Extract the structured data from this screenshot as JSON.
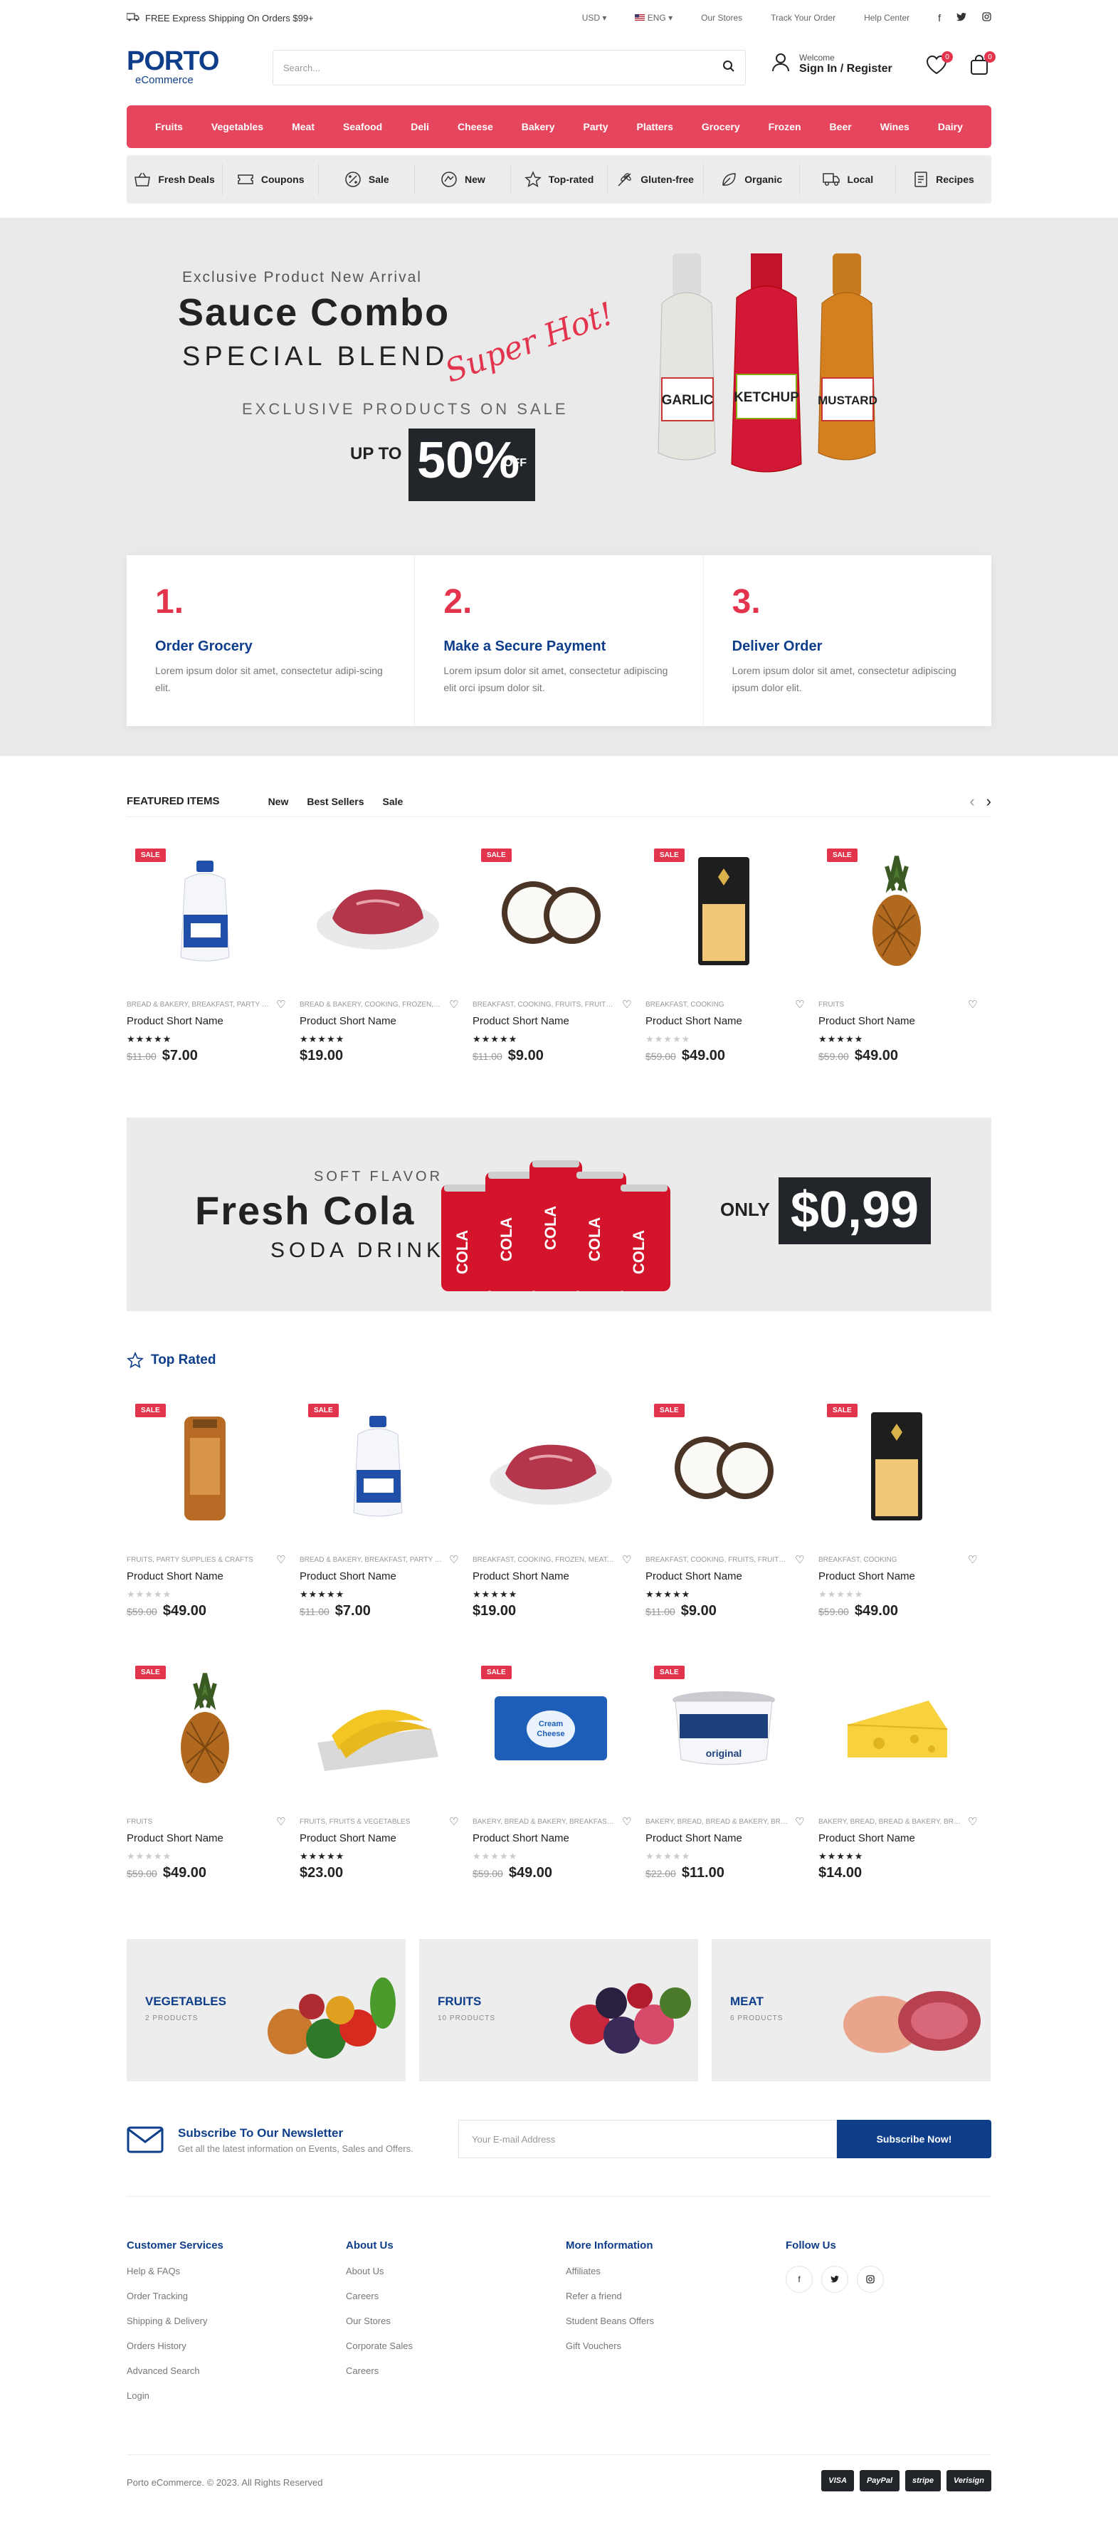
{
  "topbar": {
    "shipping": "FREE Express Shipping On Orders $99+",
    "currency": "USD",
    "language": "ENG",
    "links": [
      "Our Stores",
      "Track Your Order",
      "Help Center"
    ]
  },
  "header": {
    "logo_main": "PORTO",
    "logo_sub": "eCommerce",
    "search_placeholder": "Search...",
    "welcome": "Welcome",
    "signin": "Sign In / Register",
    "wishlist_count": "0",
    "cart_count": "0"
  },
  "categories": [
    "Fruits",
    "Vegetables",
    "Meat",
    "Seafood",
    "Deli",
    "Cheese",
    "Bakery",
    "Party",
    "Platters",
    "Grocery",
    "Frozen",
    "Beer",
    "Wines",
    "Dairy"
  ],
  "subnav": [
    {
      "label": "Fresh Deals",
      "icon": "basket-icon"
    },
    {
      "label": "Coupons",
      "icon": "coupon-icon"
    },
    {
      "label": "Sale",
      "icon": "percent-icon"
    },
    {
      "label": "New",
      "icon": "new-badge-icon"
    },
    {
      "label": "Top-rated",
      "icon": "star-icon"
    },
    {
      "label": "Gluten-free",
      "icon": "wheat-icon"
    },
    {
      "label": "Organic",
      "icon": "leaf-icon"
    },
    {
      "label": "Local",
      "icon": "truck-icon"
    },
    {
      "label": "Recipes",
      "icon": "recipe-icon"
    }
  ],
  "hero": {
    "pre": "Exclusive Product New Arrival",
    "title": "Sauce Combo",
    "subtitle": "SPECIAL BLEND",
    "script": "Super Hot!",
    "exclusive": "EXCLUSIVE PRODUCTS ON SALE",
    "upto": "UP TO",
    "percent": "50%",
    "off": "OFF",
    "bottles": [
      "GARLIC",
      "KETCHUP",
      "MUSTARD"
    ]
  },
  "steps": [
    {
      "num": "1.",
      "title": "Order Grocery",
      "desc": "Lorem ipsum dolor sit amet, consectetur adipi-scing elit."
    },
    {
      "num": "2.",
      "title": "Make a Secure Payment",
      "desc": "Lorem ipsum dolor sit amet, consectetur adipiscing elit orci ipsum dolor sit."
    },
    {
      "num": "3.",
      "title": "Deliver Order",
      "desc": "Lorem ipsum dolor sit amet, consectetur adipiscing ipsum dolor elit."
    }
  ],
  "featured": {
    "title": "FEATURED ITEMS",
    "tabs": [
      "New",
      "Best Sellers",
      "Sale"
    ],
    "products": [
      {
        "cat": "BREAD & BAKERY, BREAKFAST, PARTY SU...",
        "name": "Product Short Name",
        "old": "$11.00",
        "price": "$7.00",
        "sale": true,
        "rated": true,
        "img": "milk"
      },
      {
        "cat": "BREAD & BAKERY, COOKING, FROZEN, MEAT, M...",
        "name": "Product Short Name",
        "old": "",
        "price": "$19.00",
        "sale": false,
        "rated": true,
        "img": "meat"
      },
      {
        "cat": "BREAKFAST, COOKING, FRUITS, FRUITS & ...",
        "name": "Product Short Name",
        "old": "$11.00",
        "price": "$9.00",
        "sale": true,
        "rated": true,
        "img": "coconut"
      },
      {
        "cat": "BREAKFAST, COOKING",
        "name": "Product Short Name",
        "old": "$59.00",
        "price": "$49.00",
        "sale": true,
        "rated": false,
        "img": "pasta"
      },
      {
        "cat": "FRUITS",
        "name": "Product Short Name",
        "old": "$59.00",
        "price": "$49.00",
        "sale": true,
        "rated": true,
        "img": "pineapple"
      }
    ]
  },
  "cola": {
    "flavor": "SOFT FLAVOR",
    "title": "Fresh Cola",
    "subtitle": "SODA DRINK",
    "only": "ONLY",
    "price": "$0,99",
    "can_label": "COLA"
  },
  "top_rated": {
    "title": "Top Rated",
    "products": [
      {
        "cat": "FRUITS, PARTY SUPPLIES & CRAFTS",
        "name": "Product Short Name",
        "old": "$59.00",
        "price": "$49.00",
        "sale": true,
        "rated": false,
        "img": "bread"
      },
      {
        "cat": "BREAD & BAKERY, BREAKFAST, PARTY SU...",
        "name": "Product Short Name",
        "old": "$11.00",
        "price": "$7.00",
        "sale": true,
        "rated": true,
        "img": "milk"
      },
      {
        "cat": "BREAKFAST, COOKING, FROZEN, MEAT, M...",
        "name": "Product Short Name",
        "old": "",
        "price": "$19.00",
        "sale": false,
        "rated": true,
        "img": "meat"
      },
      {
        "cat": "BREAKFAST, COOKING, FRUITS, FRUITS & ...",
        "name": "Product Short Name",
        "old": "$11.00",
        "price": "$9.00",
        "sale": true,
        "rated": true,
        "img": "coconut"
      },
      {
        "cat": "BREAKFAST, COOKING",
        "name": "Product Short Name",
        "old": "$59.00",
        "price": "$49.00",
        "sale": true,
        "rated": false,
        "img": "pasta"
      },
      {
        "cat": "FRUITS",
        "name": "Product Short Name",
        "old": "$59.00",
        "price": "$49.00",
        "sale": true,
        "rated": false,
        "img": "pineapple"
      },
      {
        "cat": "FRUITS, FRUITS & VEGETABLES",
        "name": "Product Short Name",
        "old": "",
        "price": "$23.00",
        "sale": false,
        "rated": true,
        "img": "banana"
      },
      {
        "cat": "BAKERY, BREAD & BAKERY, BREAKFAST, F...",
        "name": "Product Short Name",
        "old": "$59.00",
        "price": "$49.00",
        "sale": true,
        "rated": false,
        "img": "cheesebox"
      },
      {
        "cat": "BAKERY, BREAD, BREAD & BAKERY, BREA...",
        "name": "Product Short Name",
        "old": "$22.00",
        "price": "$11.00",
        "sale": true,
        "rated": false,
        "img": "yogurt"
      },
      {
        "cat": "BAKERY, BREAD, BREAD & BAKERY, BRE...",
        "name": "Product Short Name",
        "old": "",
        "price": "$14.00",
        "sale": false,
        "rated": true,
        "img": "cheese"
      }
    ]
  },
  "sale_label": "SALE",
  "category_boxes": [
    {
      "title": "VEGETABLES",
      "count": "2 PRODUCTS"
    },
    {
      "title": "FRUITS",
      "count": "10 PRODUCTS"
    },
    {
      "title": "MEAT",
      "count": "6 PRODUCTS"
    }
  ],
  "newsletter": {
    "title": "Subscribe To Our Newsletter",
    "desc": "Get all the latest information on Events, Sales and Offers.",
    "placeholder": "Your E-mail Address",
    "button": "Subscribe Now!"
  },
  "footer": {
    "customer": {
      "title": "Customer Services",
      "links": [
        "Help & FAQs",
        "Order Tracking",
        "Shipping & Delivery",
        "Orders History",
        "Advanced Search",
        "Login"
      ]
    },
    "about": {
      "title": "About Us",
      "links": [
        "About Us",
        "Careers",
        "Our Stores",
        "Corporate Sales",
        "Careers"
      ]
    },
    "more": {
      "title": "More Information",
      "links": [
        "Affiliates",
        "Refer a friend",
        "Student Beans Offers",
        "Gift Vouchers"
      ]
    },
    "follow": {
      "title": "Follow Us"
    },
    "copyright": "Porto eCommerce. © 2023. All Rights Reserved",
    "payments": [
      "VISA",
      "PayPal",
      "stripe",
      "Verisign"
    ]
  },
  "colors": {
    "accent": "#e5465d",
    "brand": "#0e3e8a",
    "dark": "#222529"
  }
}
